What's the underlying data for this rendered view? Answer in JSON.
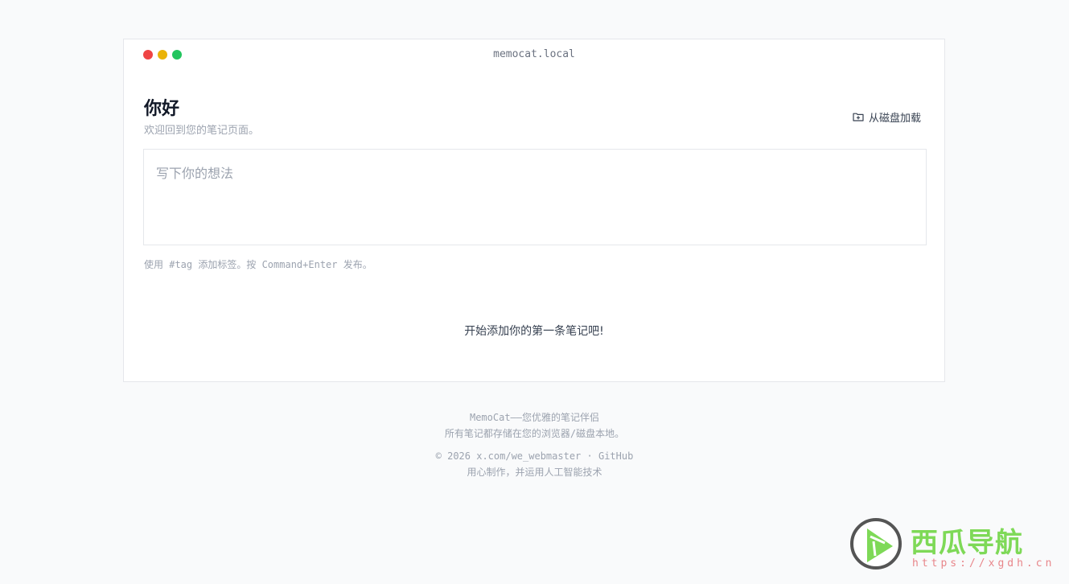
{
  "window": {
    "title": "memocat.local"
  },
  "header": {
    "greeting": "你好",
    "subtitle": "欢迎回到您的笔记页面。",
    "load_button": {
      "icon": "folder-plus-icon",
      "label": "从磁盘加载"
    }
  },
  "editor": {
    "value": "",
    "placeholder": "写下你的想法",
    "hint": "使用 #tag 添加标签。按 Command+Enter 发布。"
  },
  "notes": {
    "empty_message": "开始添加你的第一条笔记吧!"
  },
  "footer": {
    "tagline": "MemoCat——您优雅的笔记伴侣",
    "storage_note": "所有笔记都存储在您的浏览器/磁盘本地。",
    "copyright": "© 2026",
    "author_link": "x.com/we_webmaster",
    "separator": "·",
    "github_link": "GitHub",
    "made_with": "用心制作，并运用人工智能技术"
  },
  "watermark": {
    "name": "西瓜导航",
    "url": "https://xgdh.cn"
  },
  "colors": {
    "dot_red": "#ef4444",
    "dot_yellow": "#eab308",
    "dot_green": "#22c55e",
    "watermark_green": "#7ed957"
  }
}
